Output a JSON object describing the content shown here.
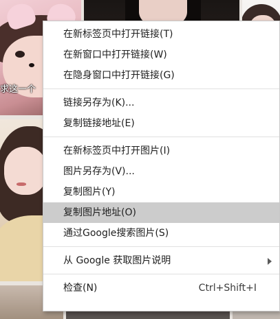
{
  "background": {
    "caption_fragment": "求这一个"
  },
  "context_menu": {
    "groups": [
      {
        "items": [
          {
            "label": "在新标签页中打开链接(T)"
          },
          {
            "label": "在新窗口中打开链接(W)"
          },
          {
            "label": "在隐身窗口中打开链接(G)"
          }
        ]
      },
      {
        "items": [
          {
            "label": "链接另存为(K)..."
          },
          {
            "label": "复制链接地址(E)"
          }
        ]
      },
      {
        "items": [
          {
            "label": "在新标签页中打开图片(I)"
          },
          {
            "label": "图片另存为(V)..."
          },
          {
            "label": "复制图片(Y)"
          },
          {
            "label": "复制图片地址(O)",
            "highlighted": true
          },
          {
            "label": "通过Google搜索图片(S)"
          }
        ]
      },
      {
        "items": [
          {
            "label": "从 Google 获取图片说明",
            "submenu": true
          }
        ]
      },
      {
        "items": [
          {
            "label": "检查(N)",
            "shortcut": "Ctrl+Shift+I"
          }
        ]
      }
    ],
    "colors": {
      "highlight": "#cccccc",
      "text": "#202020",
      "background": "#ffffff"
    }
  }
}
